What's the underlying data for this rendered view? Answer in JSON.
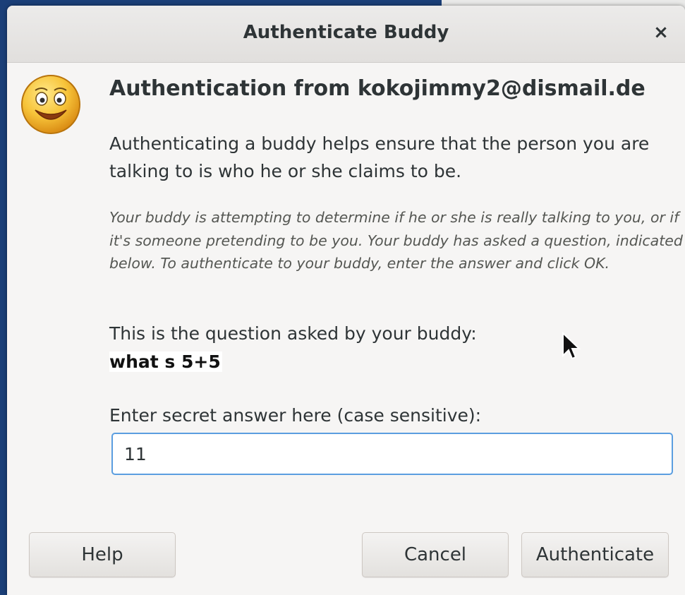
{
  "window": {
    "title": "Authenticate Buddy",
    "close_glyph": "×"
  },
  "content": {
    "icon": "smiley-face-icon",
    "heading": "Authentication from kokojimmy2@dismail.de",
    "description": "Authenticating a buddy helps ensure that the person you are talking to is who he or she claims to be.",
    "note": "Your buddy is attempting to determine if he or she is really talking to you, or if it's someone pretending to be you.  Your buddy has asked a question, indicated below.  To authenticate to your buddy, enter the answer and click OK.",
    "question_label": "This is the question asked by your buddy:",
    "question": "what s 5+5",
    "answer_label": "Enter secret answer here (case sensitive):",
    "answer_value": "11"
  },
  "buttons": {
    "help": "Help",
    "cancel": "Cancel",
    "authenticate": "Authenticate"
  },
  "colors": {
    "desktop_bg": "#1b3f78",
    "dialog_bg": "#f6f5f4",
    "focus_border": "#5b9ee0"
  }
}
